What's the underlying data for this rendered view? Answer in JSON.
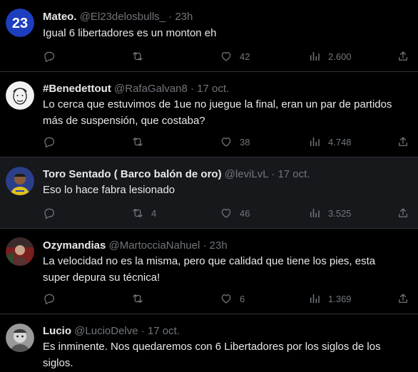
{
  "tweets": [
    {
      "name": "Mateo.",
      "handle": "@El23delosbulls_",
      "time": "23h",
      "text": "Igual 6 libertadores es un monton eh",
      "replies": "",
      "retweets": "",
      "likes": "42",
      "views": "2.600",
      "avatar_icon": "bulls-23-icon",
      "avatar_color": "#1d3fbf"
    },
    {
      "name": "#Benedettout",
      "handle": "@RafaGalvan8",
      "time": "17 oct.",
      "text": "Lo cerca que estuvimos de 1ue no juegue la final, eran un par de partidos más de suspensión, que costaba?",
      "replies": "",
      "retweets": "",
      "likes": "38",
      "views": "4.748",
      "avatar_icon": "sketch-face-icon",
      "avatar_color": "#f2f2f2"
    },
    {
      "name": "Toro Sentado ( Barco balón de oro)",
      "handle": "@leviLvL",
      "time": "17 oct.",
      "text": "Eso lo hace fabra lesionado",
      "replies": "",
      "retweets": "4",
      "likes": "46",
      "views": "3.525",
      "avatar_icon": "player-photo-icon",
      "avatar_color": "#2a3f8a"
    },
    {
      "name": "Ozymandias",
      "handle": "@MartocciaNahuel",
      "time": "23h",
      "text": "La velocidad no es la misma, pero que calidad que tiene los pies, esta super depura su técnica!",
      "replies": "",
      "retweets": "",
      "likes": "6",
      "views": "1.369",
      "avatar_icon": "portrait-photo-icon",
      "avatar_color": "#7a1e1e"
    },
    {
      "name": "Lucio",
      "handle": "@LucioDelve",
      "time": "17 oct.",
      "text": "Es inminente. Nos quedaremos con 6 Libertadores por los siglos de los siglos.",
      "avatar_icon": "grayscale-photo-icon",
      "avatar_color": "#9a9a9a"
    }
  ]
}
